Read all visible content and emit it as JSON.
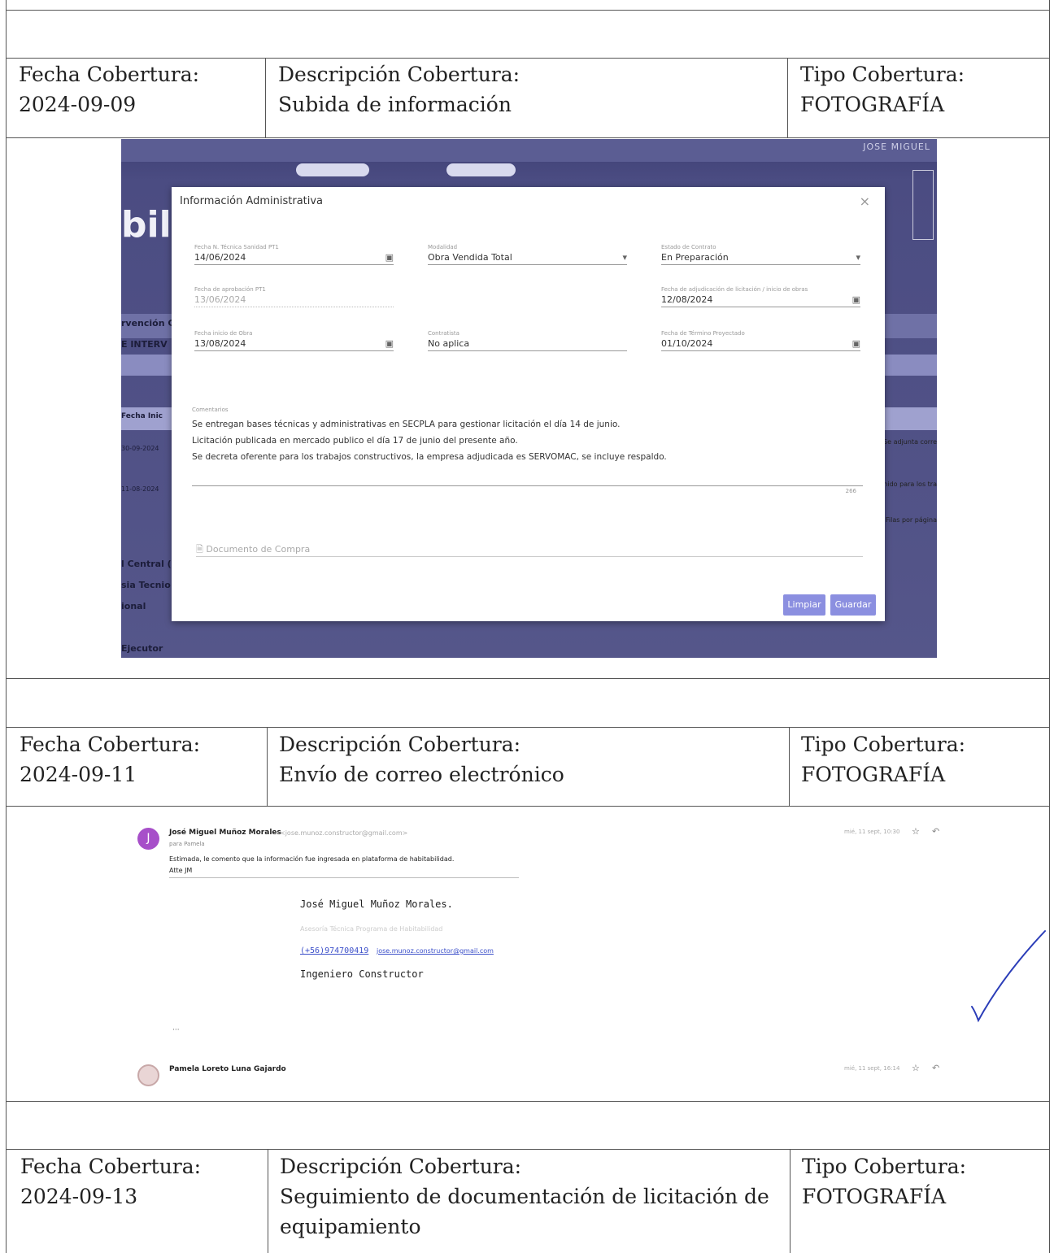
{
  "rows": [
    {
      "fecha_label": "Fecha Cobertura:",
      "fecha": "2024-09-09",
      "desc_label": "Descripción Cobertura:",
      "desc": "Subida de información",
      "tipo_label": "Tipo Cobertura:",
      "tipo": "FOTOGRAFÍA"
    },
    {
      "fecha_label": "Fecha Cobertura:",
      "fecha": "2024-09-11",
      "desc_label": "Descripción Cobertura:",
      "desc": "Envío de correo electrónico",
      "tipo_label": "Tipo Cobertura:",
      "tipo": "FOTOGRAFÍA"
    },
    {
      "fecha_label": "Fecha Cobertura:",
      "fecha": "2024-09-13",
      "desc_label": "Descripción Cobertura:",
      "desc_line1": "Seguimiento de documentación de licitación de",
      "desc_line2": "equipamiento",
      "tipo_label": "Tipo Cobertura:",
      "tipo": "FOTOGRAFÍA"
    }
  ],
  "photo1": {
    "user": "JOSE MIGUEL",
    "bg_text": "bili",
    "side_labels": [
      "rvención C",
      "E INTERV",
      "Fecha Inic",
      "30-09-2024",
      "11-08-2024",
      "l Central (",
      "sia Tecnio",
      "ional",
      "Ejecutor"
    ],
    "right_labels": [
      "Se adjunta corre",
      "nido para los tra",
      "Filas por página"
    ],
    "modal": {
      "title": "Información Administrativa",
      "close": "×",
      "fields": [
        {
          "label": "Fecha N. Técnica Sanidad PT1",
          "value": "14/06/2024",
          "icon": "calendar-icon"
        },
        {
          "label": "Modalidad",
          "value": "Obra Vendida Total",
          "icon": "dropdown-icon"
        },
        {
          "label": "Estado de Contrato",
          "value": "En Preparación",
          "icon": "dropdown-icon"
        },
        {
          "label": "Fecha de aprobación PT1",
          "value": "13/06/2024",
          "icon": ""
        },
        {
          "label": "Fecha de adjudicación de licitación / inicio de obras",
          "value": "12/08/2024",
          "icon": "calendar-icon"
        },
        {
          "label": "Fecha inicio de Obra",
          "value": "13/08/2024",
          "icon": "calendar-icon"
        },
        {
          "label": "Contratista",
          "value": "No aplica",
          "icon": ""
        },
        {
          "label": "Fecha de Término Proyectado",
          "value": "01/10/2024",
          "icon": "calendar-icon"
        }
      ],
      "comment_label": "Comentarios",
      "comment_lines": [
        "Se entregan bases técnicas y administrativas en SECPLA para gestionar licitación el día 14 de junio.",
        "Licitación publicada en mercado publico el día 17 de junio del presente año.",
        "Se decreta oferente para los trabajos constructivos, la empresa adjudicada es SERVOMAC, se incluye respaldo."
      ],
      "counter": "266",
      "doc_placeholder": "Documento de Compra",
      "btn_clear": "Limpiar",
      "btn_save": "Guardar"
    }
  },
  "photo2": {
    "sender": "José Miguel Muñoz Morales",
    "sender_email": "<jose.munoz.constructor@gmail.com>",
    "to": "para Pamela",
    "date1": "mié, 11 sept, 10:30",
    "body_line1": "Estimada, le comento que la información fue ingresada en plataforma de habitabilidad.",
    "body_line2": "Atte JM",
    "sig_name": "José Miguel Muñoz Morales.",
    "sig_sub": "Asesoría Técnica Programa de Habitabilidad",
    "sig_phone": "(+56)974700419",
    "sig_email": "jose.munoz.constructor@gmail.com",
    "sig_title": "Ingeniero Constructor",
    "ellipsis": "···",
    "sender2": "Pamela Loreto Luna Gajardo",
    "date2": "mié, 11 sept, 16:14",
    "avatar_letter": "J",
    "avatar_color": "#a74fc9"
  },
  "colors": {
    "grid": "#555555",
    "modal_button": "#8b8fe0",
    "link": "#3b4fc9",
    "checkmark": "#2b3db8"
  }
}
